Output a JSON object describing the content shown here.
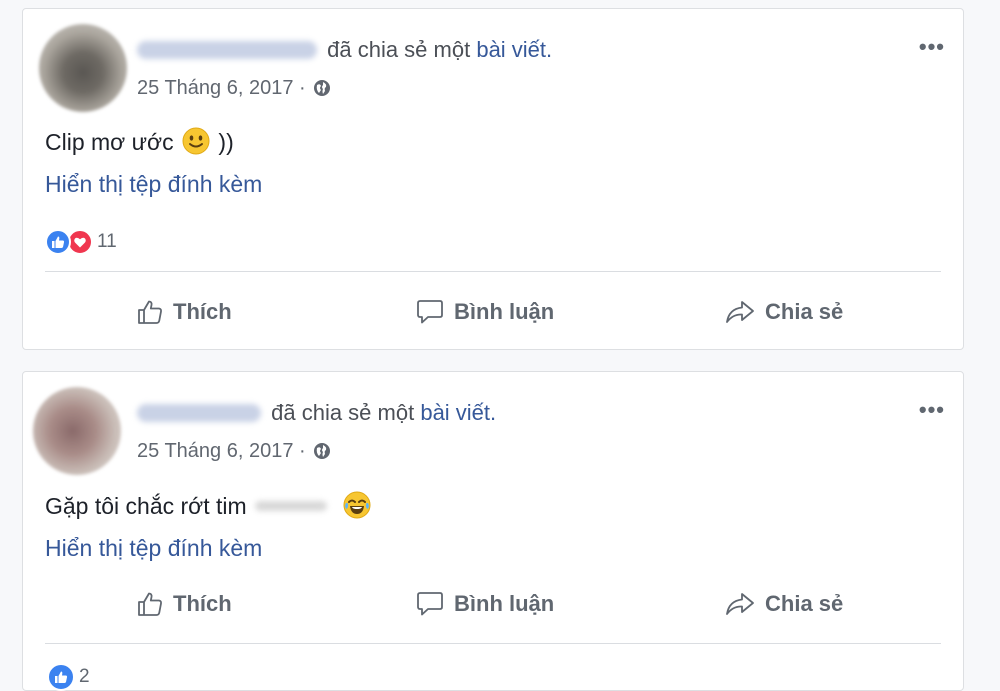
{
  "posts": [
    {
      "shared_text": "đã chia sẻ một",
      "post_link": "bài viết.",
      "date": "25 Tháng 6, 2017 ·",
      "more": "•••",
      "text_before": "Clip mơ ước",
      "text_after": "))",
      "emoji": "slightly-smiling-face",
      "show_attachment": "Hiển thị tệp đính kèm",
      "reaction_count": "11",
      "actions": {
        "like": "Thích",
        "comment": "Bình luận",
        "share": "Chia sẻ"
      }
    },
    {
      "shared_text": "đã chia sẻ một",
      "post_link": "bài viết.",
      "date": "25 Tháng 6, 2017 ·",
      "more": "•••",
      "text_before": "Gặp tôi chắc rớt tim",
      "emoji": "tears-of-joy-face",
      "show_attachment": "Hiển thị tệp đính kèm",
      "reaction_count": "2",
      "actions": {
        "like": "Thích",
        "comment": "Bình luận",
        "share": "Chia sẻ"
      }
    }
  ],
  "colors": {
    "link": "#365899",
    "like_blue": "#3b82f0",
    "love_red": "#f0364f",
    "muted": "#606770",
    "border": "#dddfe2"
  }
}
